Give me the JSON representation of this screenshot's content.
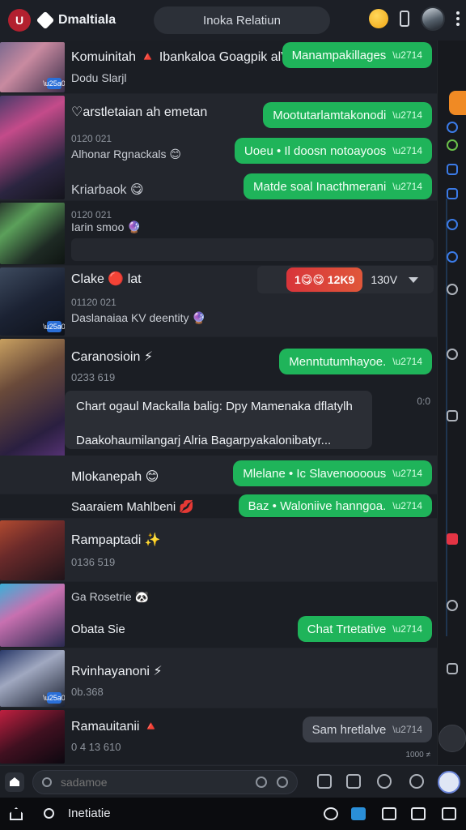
{
  "header": {
    "logo_letter": "U",
    "brand": "Dmaltiala",
    "search_title": "Inoka Relatiun"
  },
  "colors": {
    "accent_green": "#1fb45a",
    "accent_red": "#d8343a",
    "accent_blue": "#3b7be8",
    "accent_orange": "#f08a24"
  },
  "rows": [
    {
      "name": "Komuinitah 🔺 Ibankaloa Goagpik alV",
      "sub": "Dodu Slarjl",
      "bubble": "Manampakillages"
    },
    {
      "name": "♡arstletaian ah emetan",
      "meta": "0120 021",
      "sub": "Alhonar Rgnackals 😊",
      "bubble": "Mootutarlamtakonodi",
      "bubble2": "Uoeu • Il doosn notoayoos",
      "sub2": "Kriarbaok 😋",
      "bubble3": "Matde soal Inacthmerani"
    },
    {
      "meta": "0120 021",
      "sub": "Iarin smoo 🔮"
    },
    {
      "name": "Clake 🔴 lat",
      "meta": "01120 021",
      "sub": "Daslanaiaa KV deentity 🔮",
      "reaction": "1😋😋 12K9",
      "reaction_count": "130V"
    },
    {
      "name": "Caranosioin ⚡",
      "meta": "0233 619",
      "bubble": "Menntutumhayoe.",
      "quote_line1": "Chart ogaul Mackalla balig: Dpy Mamenaka dflatylh",
      "quote_line2": "Daakohaumilangarj Alria Bagarpyakalonibatyr...",
      "timer": "0:0"
    },
    {
      "name": "Mlokanepah 😊",
      "bubble": "Mlelane • Ic Slavenoooous"
    },
    {
      "name": "Saaraiem Mahlbeni 💋",
      "bubble": "Baz • Waloniive hanngoa."
    },
    {
      "name": "Rampaptadi ✨",
      "meta": "0136 519"
    },
    {
      "sub": "Ga Rosetrie 🐼",
      "name": "Obata Sie",
      "bubble": "Chat Trtetative"
    },
    {
      "name": "Rvinhayanoni ⚡",
      "meta": "0b.368"
    },
    {
      "name": "Ramauitanii 🔺",
      "meta": "0 4 13 610",
      "bubble": "Sam hretlalve",
      "footnote": "1000 ≠"
    }
  ],
  "compose": {
    "placeholder": "sadamoe"
  },
  "system_nav": {
    "label": "Inetiatie"
  }
}
